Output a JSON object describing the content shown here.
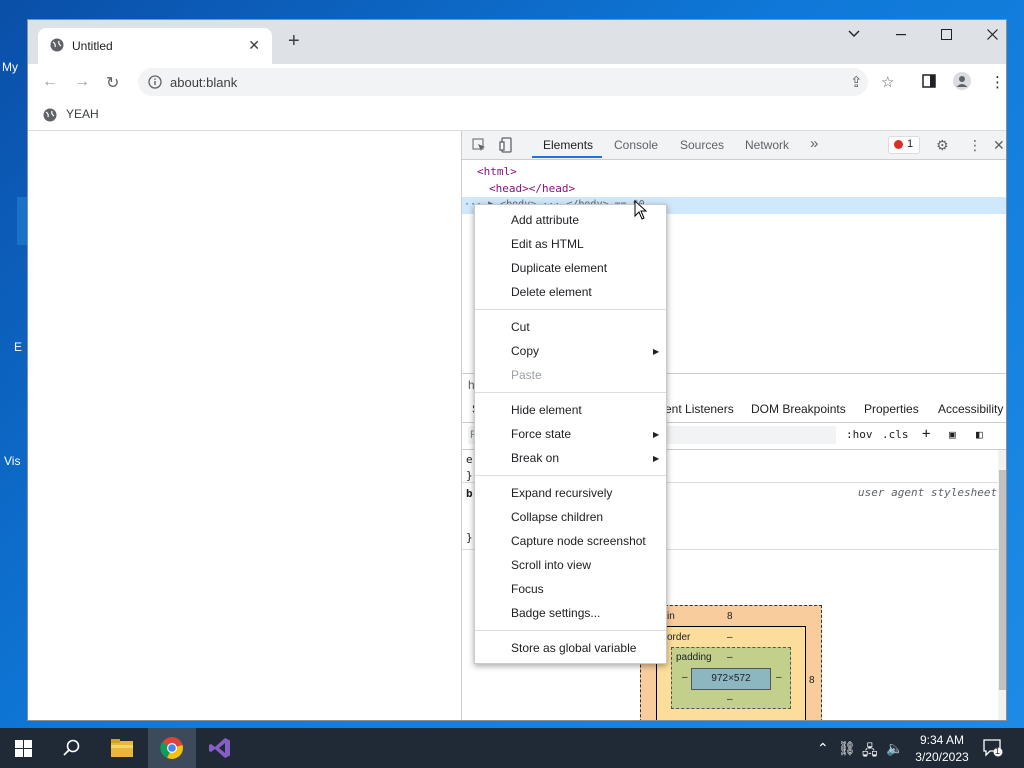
{
  "desktop": {
    "labels": [
      "My",
      "E",
      "Vis"
    ]
  },
  "browser": {
    "tab_title": "Untitled",
    "url": "about:blank",
    "bookmark": "YEAH"
  },
  "devtools": {
    "tabs": [
      "Elements",
      "Console",
      "Sources",
      "Network"
    ],
    "more_tabs": "»",
    "error_count": "1",
    "dom": {
      "html_open": "<html>",
      "head": "<head></head>",
      "selected": "··· ▶ <body> ··· </body> == $0"
    },
    "breadcrumb": "h",
    "subtabs": [
      "S",
      "ent Listeners",
      "DOM Breakpoints",
      "Properties",
      "Accessibility"
    ],
    "filter_placeholder": "F",
    "hov": ":hov",
    "cls": ".cls",
    "styles": {
      "line1": "e",
      "line2": "}",
      "line3": "b",
      "line4": "}",
      "ua": "user agent stylesheet"
    },
    "box_model": {
      "margin_label": "in",
      "margin_value": "8",
      "margin_right": "8",
      "border_label": "order",
      "border_value": "–",
      "padding_label": "padding",
      "padding_value": "–",
      "content_size": "972×572",
      "dash": "–"
    }
  },
  "context_menu": {
    "group1": [
      "Add attribute",
      "Edit as HTML",
      "Duplicate element",
      "Delete element"
    ],
    "group2": [
      "Cut",
      "Copy",
      "Paste"
    ],
    "group3": [
      "Hide element",
      "Force state",
      "Break on"
    ],
    "group4": [
      "Expand recursively",
      "Collapse children",
      "Capture node screenshot",
      "Scroll into view",
      "Focus",
      "Badge settings..."
    ],
    "group5": [
      "Store as global variable"
    ]
  },
  "taskbar": {
    "time": "9:34 AM",
    "date": "3/20/2023",
    "notifications": "1"
  },
  "colors": {
    "accent": "#1a73e8",
    "taskbar": "#1f2a36",
    "selection": "#cfe8fc"
  }
}
